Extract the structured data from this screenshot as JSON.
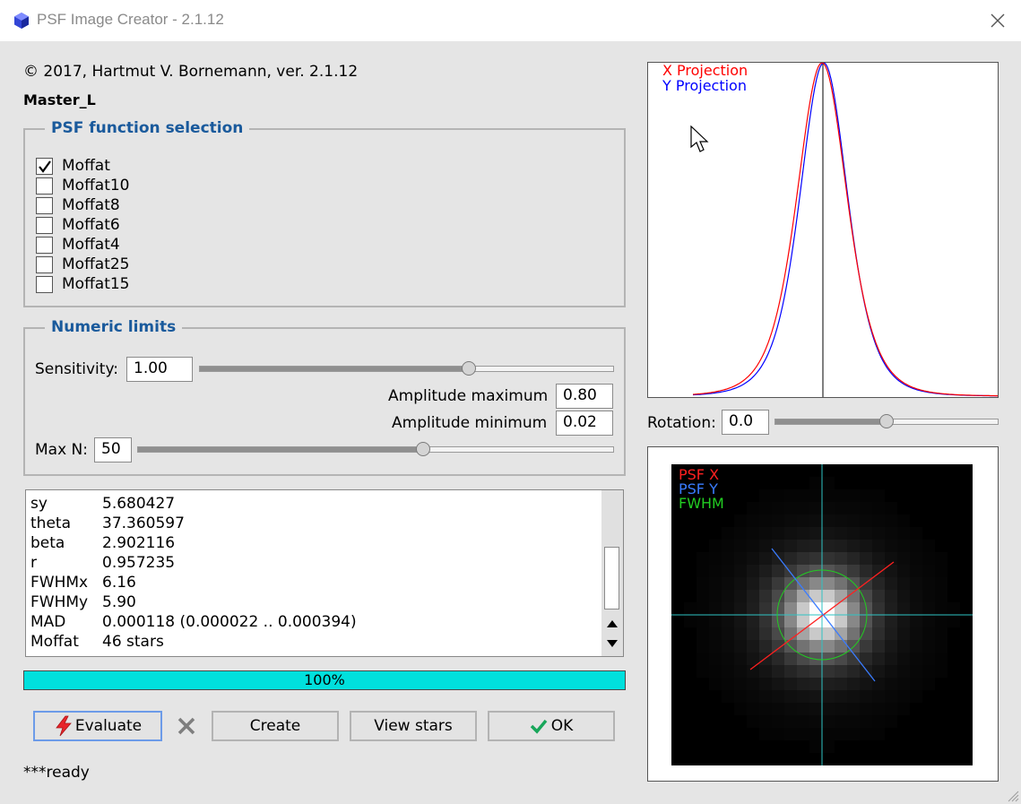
{
  "window": {
    "title": "PSF Image Creator - 2.1.12"
  },
  "header": {
    "copyright": "© 2017, Hartmut V. Bornemann, ver. 2.1.12",
    "image_name": "Master_L"
  },
  "psf_selection": {
    "title": "PSF function selection",
    "options": [
      {
        "label": "Moffat",
        "checked": true
      },
      {
        "label": "Moffat10",
        "checked": false
      },
      {
        "label": "Moffat8",
        "checked": false
      },
      {
        "label": "Moffat6",
        "checked": false
      },
      {
        "label": "Moffat4",
        "checked": false
      },
      {
        "label": "Moffat25",
        "checked": false
      },
      {
        "label": "Moffat15",
        "checked": false
      }
    ]
  },
  "numeric_limits": {
    "title": "Numeric limits",
    "sensitivity_label": "Sensitivity:",
    "sensitivity_value": "1.00",
    "sensitivity_slider_fraction": 0.65,
    "amp_max_label": "Amplitude maximum",
    "amp_max_value": "0.80",
    "amp_min_label": "Amplitude minimum",
    "amp_min_value": "0.02",
    "max_n_label": "Max N:",
    "max_n_value": "50",
    "max_n_slider_fraction": 0.6
  },
  "results": {
    "rows": [
      {
        "key": "sy",
        "value": "5.680427"
      },
      {
        "key": "theta",
        "value": "37.360597"
      },
      {
        "key": "beta",
        "value": "2.902116"
      },
      {
        "key": "r",
        "value": "0.957235"
      },
      {
        "key": "FWHMx",
        "value": "6.16"
      },
      {
        "key": "FWHMy",
        "value": "5.90"
      },
      {
        "key": "MAD",
        "value": "0.000118 (0.000022 .. 0.000394)"
      },
      {
        "key": "Moffat",
        "value": "46 stars"
      }
    ]
  },
  "progress": {
    "text": "100%",
    "percent": 100
  },
  "buttons": {
    "evaluate": "Evaluate",
    "create": "Create",
    "view_stars": "View stars",
    "ok": "OK"
  },
  "status": "***ready",
  "projection_plot": {
    "x_label": "X Projection",
    "y_label": "Y Projection",
    "x_color": "#ff0000",
    "y_color": "#0000ff"
  },
  "rotation": {
    "label": "Rotation:",
    "value": "0.0",
    "slider_fraction": 0.5
  },
  "star_view": {
    "psf_x_label": "PSF X",
    "psf_y_label": "PSF Y",
    "fwhm_label": "FWHM",
    "psf_x_color": "#ff2020",
    "psf_y_color": "#3a7cff",
    "fwhm_color": "#22cc22",
    "crosshair_color": "#2ec4c4"
  },
  "colors": {
    "accent": "#1a5a9c",
    "progress": "#00e0dd"
  }
}
